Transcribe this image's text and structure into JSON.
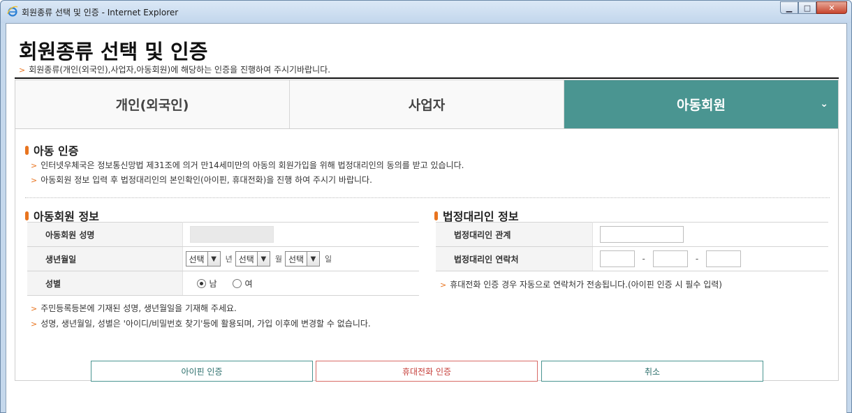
{
  "window": {
    "title": "회원종류 선택 및 인증 - Internet Explorer"
  },
  "page": {
    "title": "회원종류 선택 및 인증",
    "description": "회원종류(개인(외국인),사업자,아동회원)에 해당하는 인증을 진행하여 주시기바랍니다."
  },
  "tabs": [
    {
      "label": "개인(외국인)",
      "active": false
    },
    {
      "label": "사업자",
      "active": false
    },
    {
      "label": "아동회원",
      "active": true
    }
  ],
  "auth_section": {
    "title": "아동 인증",
    "notes": [
      "인터넷우체국은 정보통신망법 제31조에 의거 만14세미만의 아동의 회원가입을 위해 법정대리인의 동의를 받고 있습니다.",
      "아동회원 정보 입력 후 법정대리인의 본인확인(아이핀, 휴대전화)을 진행 하여 주시기 바랍니다."
    ]
  },
  "child_info": {
    "title": "아동회원 정보",
    "name_label": "아동회원 성명",
    "birth_label": "생년월일",
    "gender_label": "성별",
    "select_text": "선택",
    "year_unit": "년",
    "month_unit": "월",
    "day_unit": "일",
    "gender_male": "남",
    "gender_female": "여",
    "notes": [
      "주민등록등본에 기재된 성명, 생년월일을 기재해 주세요.",
      "성명, 생년월일, 성별은 '아이디/비밀번호 찾기'등에 활용되며, 가입 이후에 변경할 수 없습니다."
    ]
  },
  "guardian_info": {
    "title": "법정대리인 정보",
    "relation_label": "법정대리인 관계",
    "contact_label": "법정대리인 연락처",
    "contact_separator": "-",
    "note": "휴대전화 인증 경우 자동으로 연락처가 전송됩니다.(아이핀 인증 시 필수 입력)"
  },
  "buttons": {
    "ipin": "아이핀 인증",
    "mobile": "휴대전화 인증",
    "cancel": "취소"
  },
  "colors": {
    "accent_teal": "#4a9591",
    "accent_orange": "#e8741f",
    "mobile_red": "#c63f3a"
  }
}
